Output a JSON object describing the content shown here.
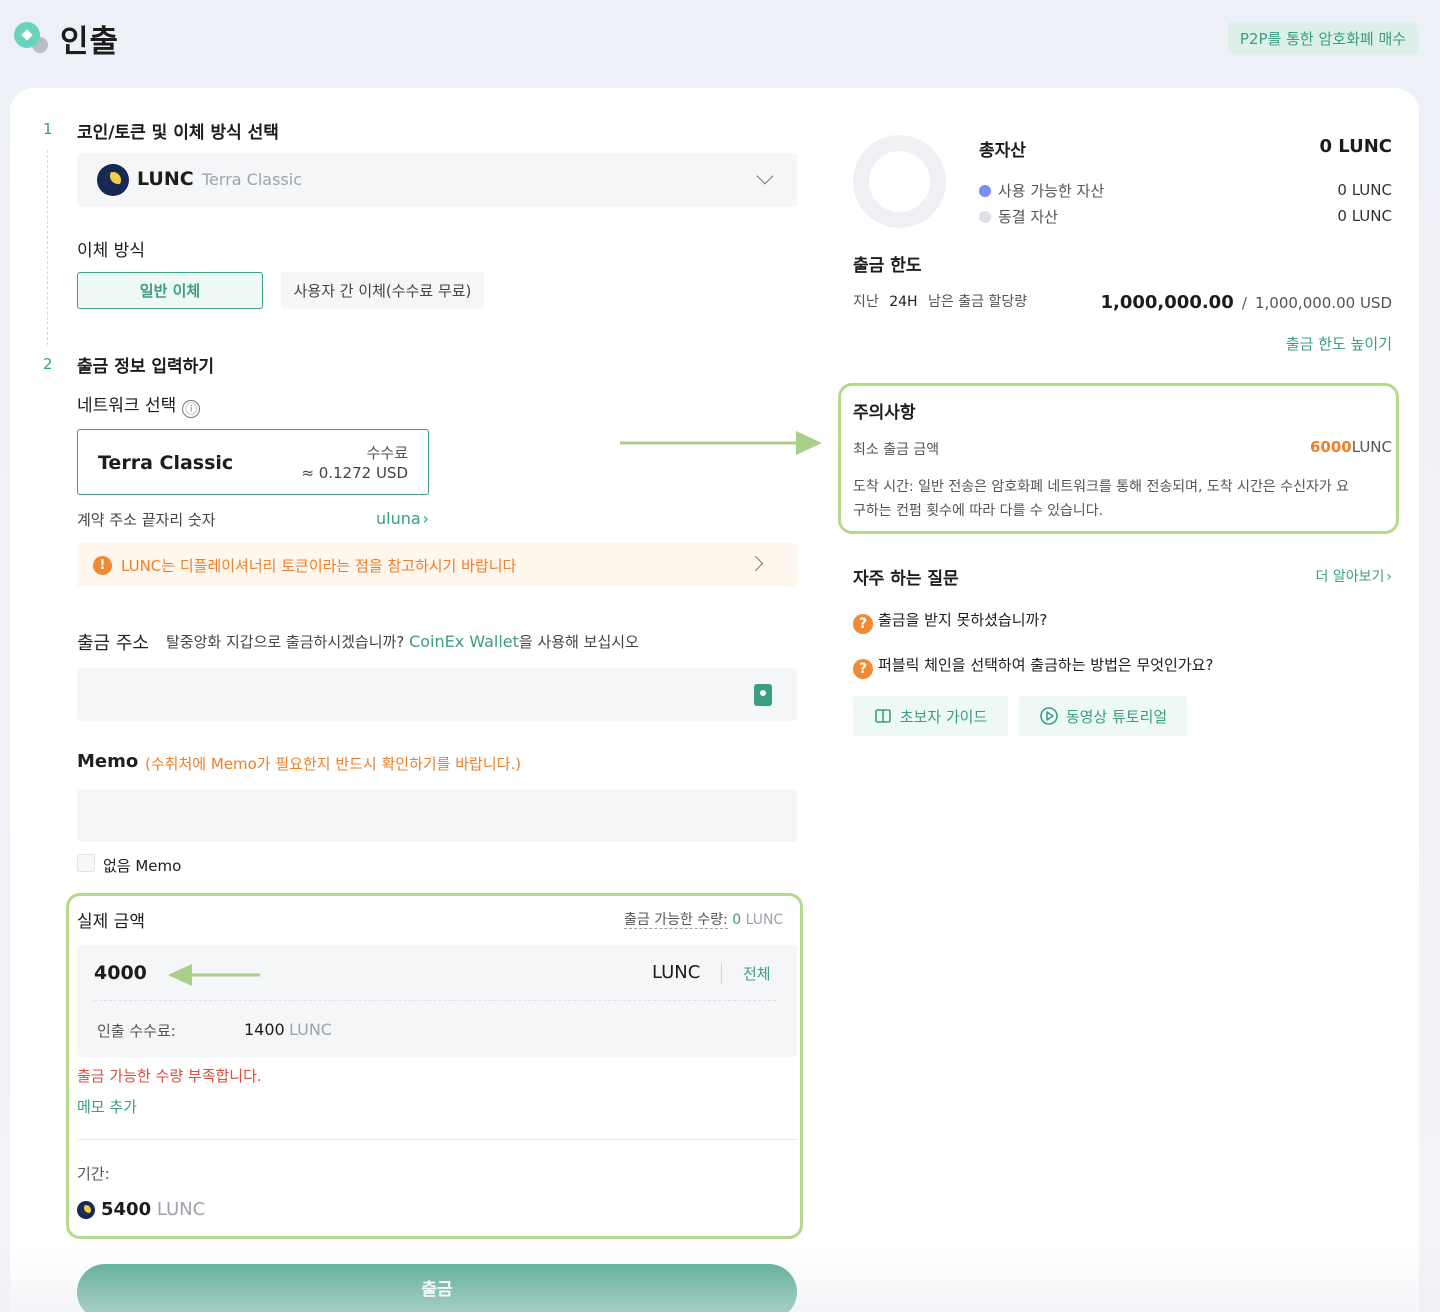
{
  "header": {
    "title": "인출",
    "p2p_button": "P2P를 통한 암호화폐 매수"
  },
  "steps": {
    "step1": {
      "num": "1",
      "title": "코인/토큰 및 이체 방식 선택"
    },
    "step2": {
      "num": "2",
      "title": "출금 정보 입력하기"
    }
  },
  "coin": {
    "symbol": "LUNC",
    "name": "Terra Classic"
  },
  "transfer": {
    "label": "이체 방식",
    "options": [
      "일반 이체",
      "사용자 간 이체(수수료 무료)"
    ]
  },
  "network": {
    "label": "네트워크 선택",
    "info_icon": "ⓘ",
    "selected": "Terra Classic",
    "fee_label": "수수료",
    "fee_value": "≈ 0.1272 USD",
    "contract_label": "계약 주소 끝자리 숫자",
    "contract_value": "uluna",
    "contract_arrow": "›"
  },
  "warning": {
    "text": "LUNC는 디플레이셔너리 토큰이라는 점을 참고하시기 바랍니다"
  },
  "address": {
    "label": "출금 주소",
    "hint_pre": "탈중앙화 지갑으로 출금하시겠습니까? ",
    "hint_link": "CoinEx Wallet",
    "hint_post": "을 사용해 보십시오",
    "value": ""
  },
  "memo": {
    "label": "Memo",
    "note": "(수취처에 Memo가 필요한지 반드시 확인하기를 바랍니다.)",
    "value": "",
    "checkbox_label": "없음 Memo"
  },
  "amount": {
    "label": "실제 금액",
    "available_label": "출금 가능한 수량:",
    "available_value": "0",
    "available_unit": "LUNC",
    "value": "4000",
    "unit": "LUNC",
    "all_label": "전체",
    "fee_label": "인출 수수료:",
    "fee_value": "1400",
    "fee_unit": "LUNC",
    "error": "출금 가능한 수량 부족합니다.",
    "add_memo": "메모 추가",
    "period_label": "기간:",
    "total_value": "5400",
    "total_unit": "LUNC"
  },
  "submit": {
    "label": "출금"
  },
  "assets": {
    "title": "총자산",
    "total": "0 LUNC",
    "available_label": "사용 가능한 자산",
    "available_value": "0 LUNC",
    "frozen_label": "동결 자산",
    "frozen_value": "0 LUNC",
    "available_color": "#7f8cf5",
    "frozen_color": "#dde0e5"
  },
  "limit": {
    "title": "출금 한도",
    "period_pre": "지난",
    "period_mid": "24H",
    "period_post": "남은 출금 할당량",
    "remaining": "1,000,000.00",
    "separator": "/",
    "total": "1,000,000.00 USD",
    "raise_link": "출금 한도 높이기"
  },
  "notice": {
    "title": "주의사항",
    "min_label": "최소 출금 금액",
    "min_value": "6000",
    "min_unit": "LUNC",
    "arrival_line1": "도착 시간: 일반 전송은 암호화폐 네트워크를 통해 전송되며, 도착 시간은 수신자가 요",
    "arrival_line2": "구하는 컨펌 횟수에 따라 다를 수 있습니다."
  },
  "faq": {
    "title": "자주 하는 질문",
    "more_link": "더 알아보기",
    "more_arrow": "›",
    "question_icon": "?",
    "questions": [
      "출금을 받지 못하셨습니까?",
      "퍼블릭 체인을 선택하여 출금하는 방법은 무엇인가요?"
    ],
    "guide_button": "초보자 가이드",
    "video_button": "동영상 튜토리얼"
  },
  "colors": {
    "accent": "#3a9d84",
    "highlight": "#b5d98c",
    "warning": "#ee7f28",
    "error": "#e04a3c"
  }
}
